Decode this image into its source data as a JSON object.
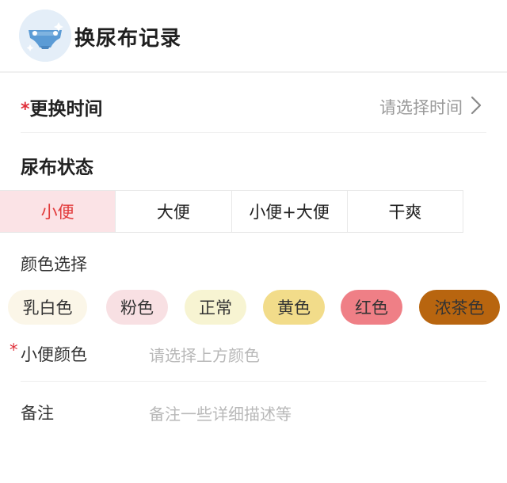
{
  "header": {
    "title": "换尿布记录",
    "avatar_icon": "diaper-icon"
  },
  "change_time": {
    "required_mark": "*",
    "label": "更换时间",
    "placeholder": "请选择时间",
    "chevron_icon": "chevron-right-icon"
  },
  "status": {
    "title": "尿布状态",
    "options": [
      {
        "label": "小便",
        "active": true
      },
      {
        "label": "大便",
        "active": false
      },
      {
        "label": "小便+大便",
        "active": false
      },
      {
        "label": "干爽",
        "active": false
      }
    ]
  },
  "color_select": {
    "title": "颜色选择",
    "chips": [
      {
        "label": "乳白色",
        "color": "#fbf6e8"
      },
      {
        "label": "粉色",
        "color": "#f8e0e3"
      },
      {
        "label": "正常",
        "color": "#f7f4d2"
      },
      {
        "label": "黄色",
        "color": "#f2dc8a"
      },
      {
        "label": "红色",
        "color": "#ef7f86"
      },
      {
        "label": "浓茶色",
        "color": "#b8650f"
      }
    ]
  },
  "pee_color": {
    "required_mark": "*",
    "label": "小便颜色",
    "placeholder": "请选择上方颜色"
  },
  "note": {
    "label": "备注",
    "placeholder": "备注一些详细描述等"
  },
  "colors": {
    "accent_red": "#e23b3b",
    "active_bg": "#fbe3e6",
    "placeholder_gray": "#b8b8b8"
  }
}
